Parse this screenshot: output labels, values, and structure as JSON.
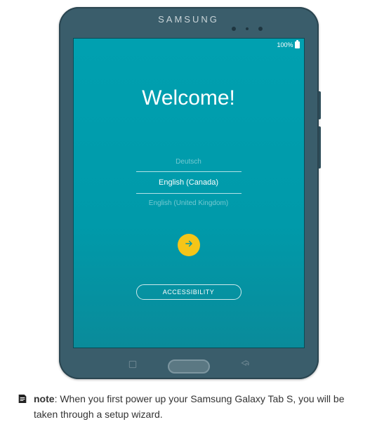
{
  "brand": "SAMSUNG",
  "statusbar": {
    "battery_text": "100%"
  },
  "welcome": {
    "title": "Welcome!"
  },
  "languages": {
    "prev": "Deutsch",
    "selected": "English (Canada)",
    "next": "English (United Kingdom)"
  },
  "buttons": {
    "accessibility": "ACCESSIBILITY"
  },
  "note": {
    "label": "note",
    "separator": ":  ",
    "text": "When you first power up your Samsung Galaxy Tab S, you will be taken through a setup wizard."
  }
}
